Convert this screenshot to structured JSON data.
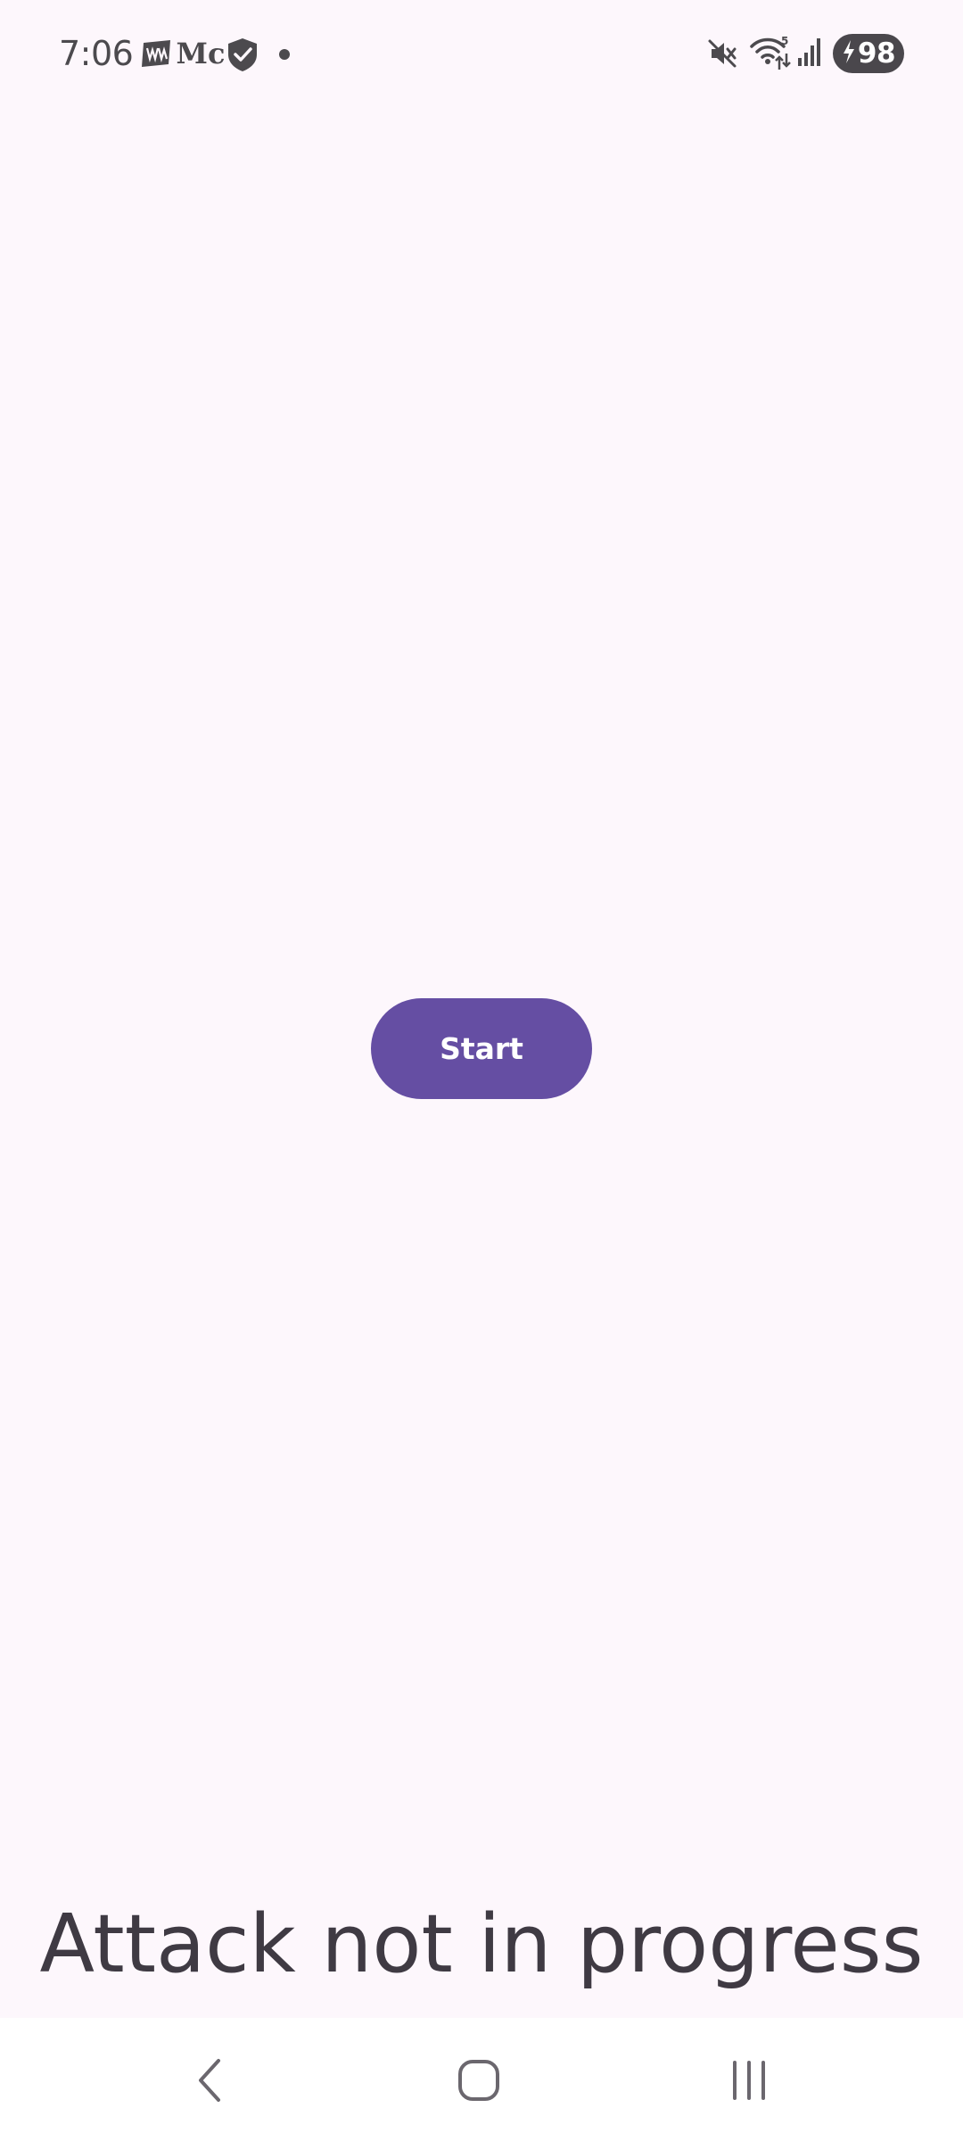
{
  "status_bar": {
    "time": "7:06",
    "icons": [
      "news-app-icon",
      "medium-app-icon",
      "shield-check-icon",
      "notification-dot-icon",
      "mute-icon",
      "wifi-icon",
      "signal-icon",
      "charging-bolt-icon"
    ],
    "app_icon_2_text": "Mc",
    "battery_level": "98"
  },
  "main": {
    "start_button_label": "Start",
    "attack_status": "Attack not in progress"
  },
  "colors": {
    "background": "#fdf7fc",
    "button": "#654ea3",
    "text": "#3f3a43",
    "nav_bar": "#ffffff"
  },
  "nav_bar": {
    "buttons": [
      "back-icon",
      "home-icon",
      "recents-icon"
    ]
  }
}
